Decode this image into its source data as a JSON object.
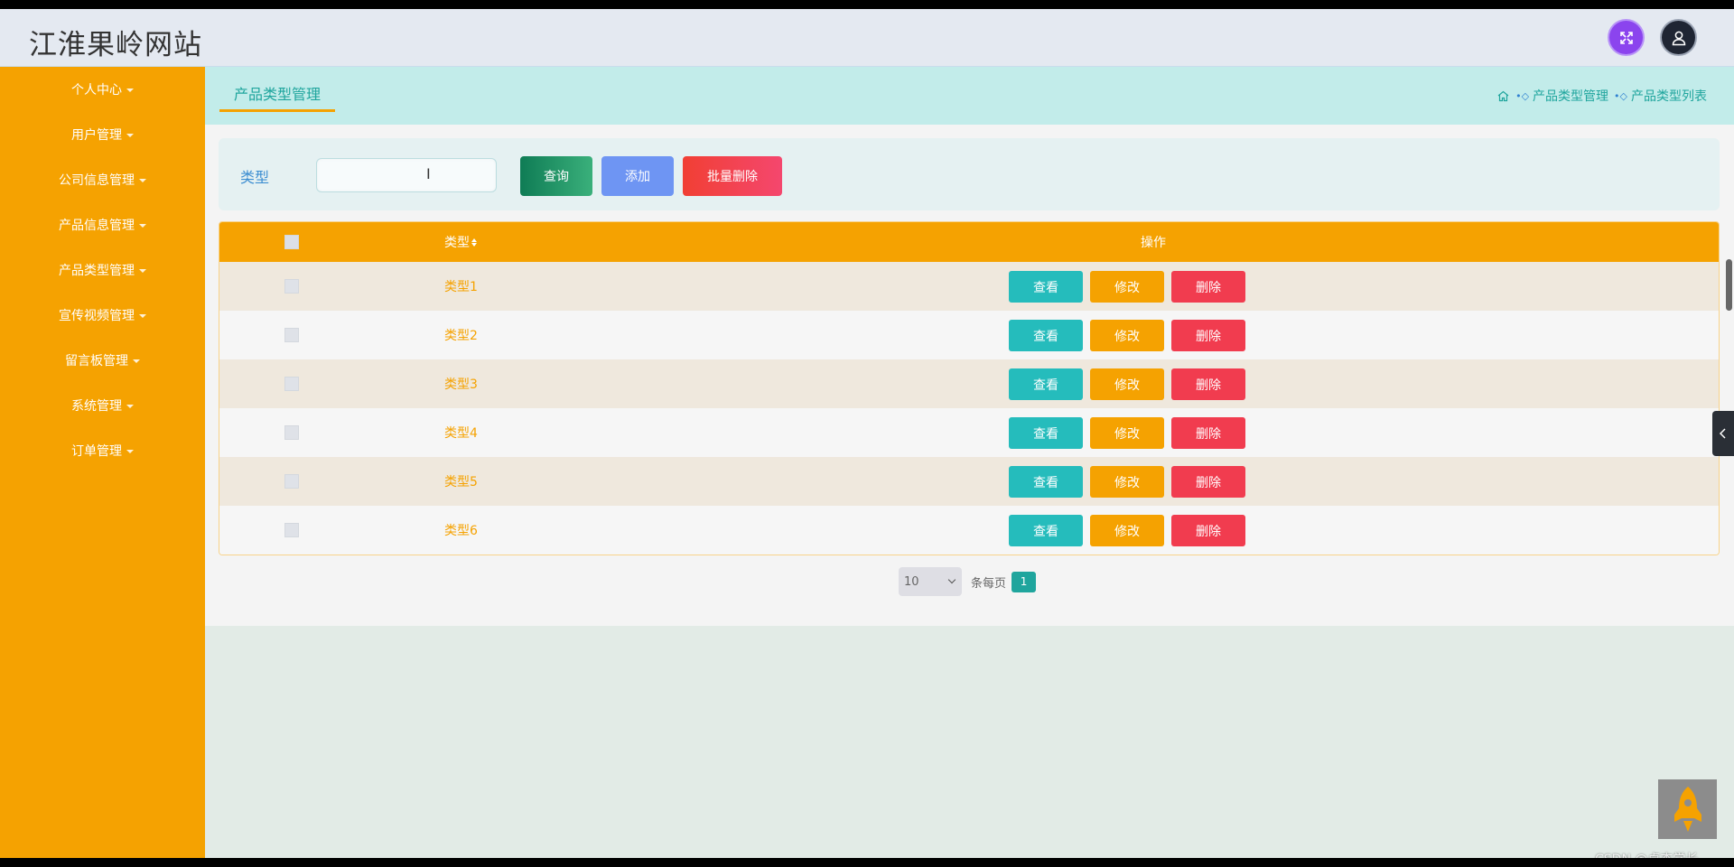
{
  "header": {
    "site_title": "江淮果岭网站"
  },
  "sidebar": {
    "items": [
      {
        "label": "个人中心"
      },
      {
        "label": "用户管理"
      },
      {
        "label": "公司信息管理"
      },
      {
        "label": "产品信息管理"
      },
      {
        "label": "产品类型管理"
      },
      {
        "label": "宣传视频管理"
      },
      {
        "label": "留言板管理"
      },
      {
        "label": "系统管理"
      },
      {
        "label": "订单管理"
      }
    ]
  },
  "tabs": {
    "active_label": "产品类型管理"
  },
  "breadcrumb": {
    "items": [
      "产品类型管理",
      "产品类型列表"
    ]
  },
  "search": {
    "field_label": "类型",
    "input_value": "",
    "query_label": "查询",
    "add_label": "添加",
    "batch_delete_label": "批量删除"
  },
  "table": {
    "columns": {
      "type": "类型",
      "operation": "操作"
    },
    "rows": [
      {
        "type": "类型1"
      },
      {
        "type": "类型2"
      },
      {
        "type": "类型3"
      },
      {
        "type": "类型4"
      },
      {
        "type": "类型5"
      },
      {
        "type": "类型6"
      }
    ],
    "actions": {
      "view": "查看",
      "edit": "修改",
      "delete": "删除"
    }
  },
  "pagination": {
    "page_size": "10",
    "per_page_label": "条每页",
    "current_page": "1"
  },
  "watermark": "CSDN @卓杰学长",
  "colors": {
    "sidebar_bg": "#f5a201",
    "accent_teal": "#1fa59d",
    "table_header": "#f5a201",
    "view_button": "#25bcbc",
    "edit_button": "#f5a201",
    "delete_button": "#f13c4f"
  },
  "icons": {
    "fullscreen": "fullscreen-icon",
    "user": "user-icon",
    "home": "home-icon",
    "collapse": "chevron-left-icon",
    "back_to_top": "rocket-icon"
  }
}
